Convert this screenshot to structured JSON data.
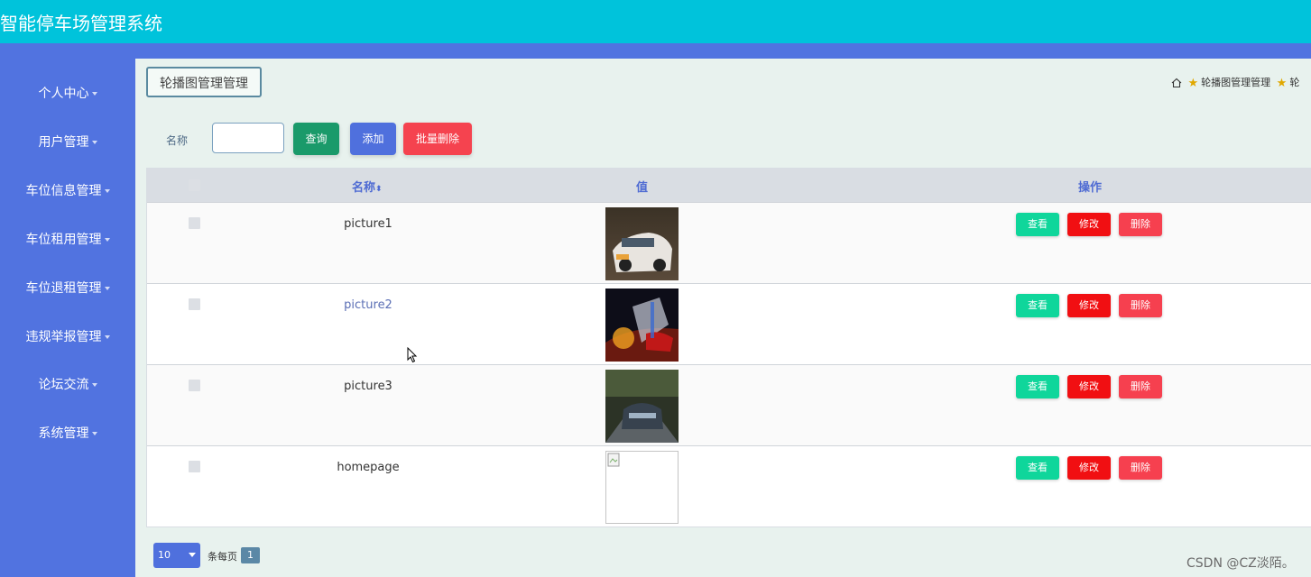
{
  "app": {
    "title": "智能停车场管理系统"
  },
  "sidebar": {
    "items": [
      {
        "label": "个人中心"
      },
      {
        "label": "用户管理"
      },
      {
        "label": "车位信息管理"
      },
      {
        "label": "车位租用管理"
      },
      {
        "label": "车位退租管理"
      },
      {
        "label": "违规举报管理"
      },
      {
        "label": "论坛交流"
      },
      {
        "label": "系统管理"
      }
    ]
  },
  "page": {
    "title": "轮播图管理管理",
    "breadcrumb": {
      "item1": "轮播图管理管理",
      "item2": "轮"
    }
  },
  "search": {
    "label": "名称",
    "input_value": "",
    "query_button": "查询",
    "add_button": "添加",
    "batch_delete_button": "批量删除"
  },
  "table": {
    "headers": {
      "name": "名称",
      "value": "值",
      "actions": "操作"
    },
    "rows": [
      {
        "name": "picture1",
        "image": "car-photo"
      },
      {
        "name": "picture2",
        "image": "car-photo"
      },
      {
        "name": "picture3",
        "image": "car-photo"
      },
      {
        "name": "homepage",
        "image": "broken-image"
      }
    ],
    "action_labels": {
      "view": "查看",
      "edit": "修改",
      "delete": "删除"
    }
  },
  "pagination": {
    "page_size": "10",
    "per_page_label": "条每页",
    "current_page": "1"
  },
  "watermark": "CSDN @CZ淡陌。",
  "colors": {
    "header": "#00c3db",
    "sidebar": "#5173e0",
    "query": "#1a9a6a",
    "add": "#4f70dd",
    "batch_delete": "#f5434f",
    "view": "#0fd69b",
    "edit": "#f10f12",
    "delete": "#f6404f"
  }
}
